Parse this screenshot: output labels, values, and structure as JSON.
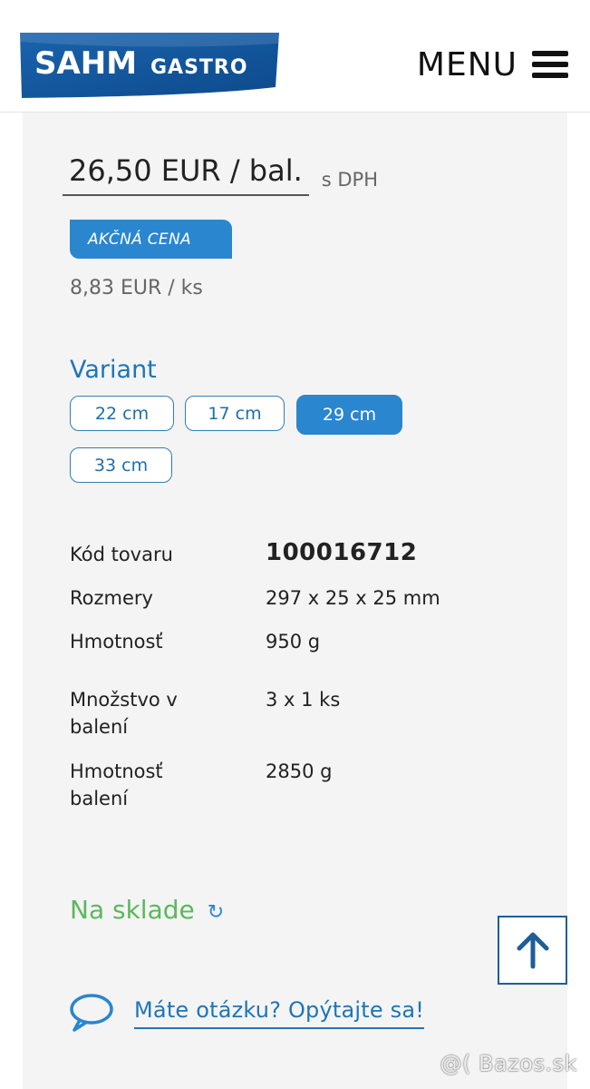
{
  "header": {
    "logo_primary": "SAHM",
    "logo_secondary": "GASTRO",
    "menu_label": "MENU"
  },
  "product": {
    "price": "26,50 EUR / bal.",
    "vat_note": "s DPH",
    "sale_badge": "AKČNÁ CENA",
    "unit_price": "8,83 EUR / ks"
  },
  "variant": {
    "title": "Variant",
    "options": [
      "22 cm",
      "17 cm",
      "29 cm",
      "33 cm"
    ],
    "selected": "29 cm"
  },
  "specs": [
    {
      "label": "Kód tovaru",
      "value": "100016712"
    },
    {
      "label": "Rozmery",
      "value": "297 x 25 x 25 mm"
    },
    {
      "label": "Hmotnosť",
      "value": "950 g"
    },
    {
      "label": "Množstvo v balení",
      "value": "3 x 1 ks"
    },
    {
      "label": "Hmotnosť balení",
      "value": "2850 g"
    }
  ],
  "availability": {
    "label": "Na sklade"
  },
  "question": {
    "link_text": "Máte otázku? Opýtajte sa!"
  },
  "watermark": "@( Bazos.sk",
  "colors": {
    "brand_blue": "#2a86cf",
    "link_blue": "#1f75b8",
    "stock_green": "#5cb85c",
    "card_bg": "#f4f4f4"
  }
}
